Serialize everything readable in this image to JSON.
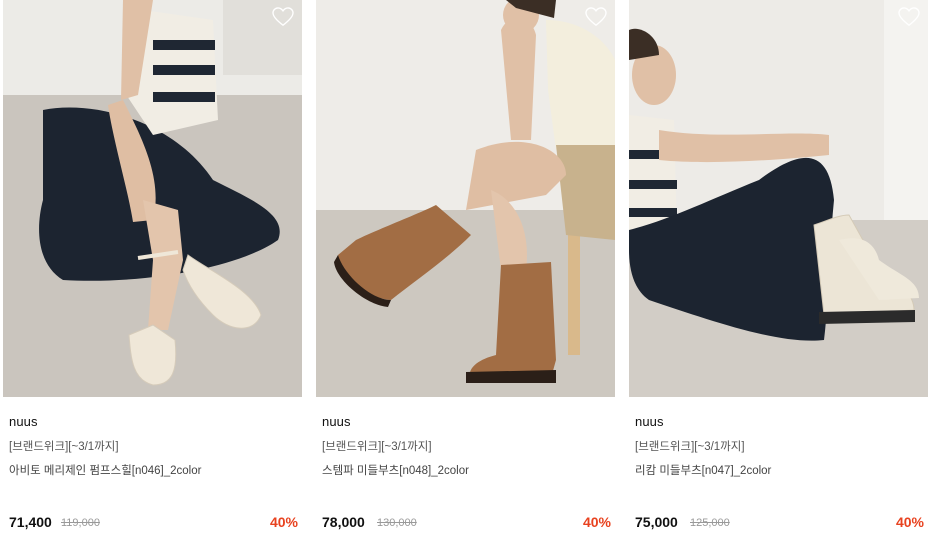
{
  "products": [
    {
      "brand": "nuus",
      "promo": "[브랜드위크][~3/1까지]",
      "name": "아비토 메리제인 펌프스힐[n046]_2color",
      "price": "71,400",
      "original_price": "119,000",
      "discount": "40%",
      "image_icon": "model-wearing-cream-maryjane-pumps"
    },
    {
      "brand": "nuus",
      "promo": "[브랜드위크][~3/1까지]",
      "name": "스템파 미들부츠[n048]_2color",
      "price": "78,000",
      "original_price": "130,000",
      "discount": "40%",
      "image_icon": "model-wearing-brown-middle-boots"
    },
    {
      "brand": "nuus",
      "promo": "[브랜드위크][~3/1까지]",
      "name": "리캄 미들부츠[n047]_2color",
      "price": "75,000",
      "original_price": "125,000",
      "discount": "40%",
      "image_icon": "model-wearing-ivory-middle-boots"
    }
  ],
  "colors": {
    "discount": "#e8421f",
    "price": "#111111",
    "original_price": "#999999"
  },
  "wish_icon": "heart-outline-icon"
}
